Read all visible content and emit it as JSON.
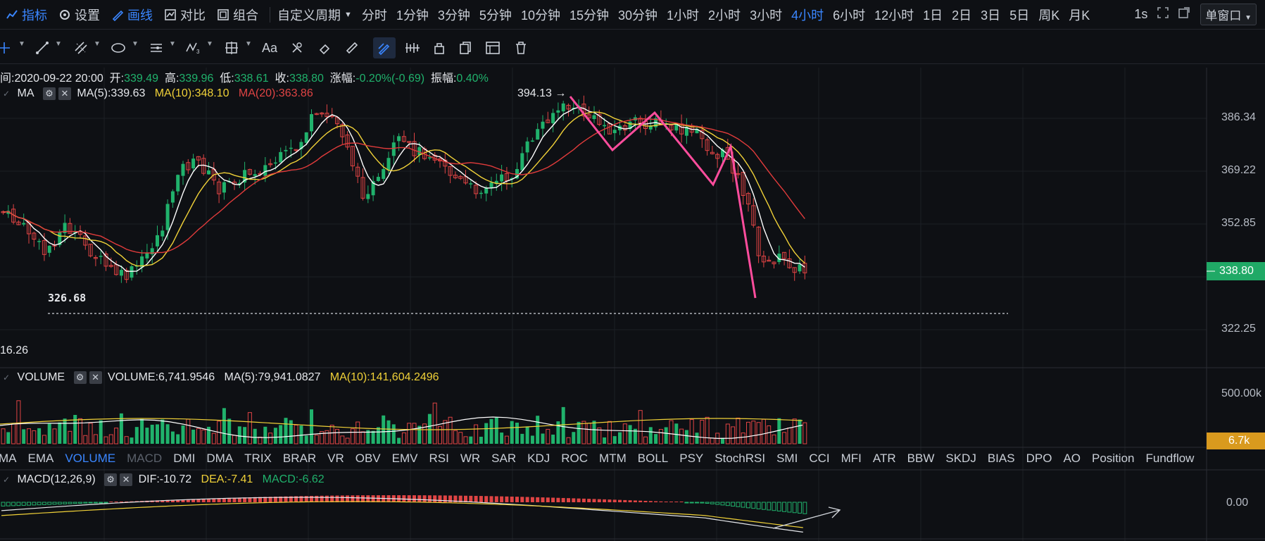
{
  "topbar": {
    "left": [
      {
        "icon": "indicator-icon",
        "label": "指标",
        "active": true
      },
      {
        "icon": "settings-icon",
        "label": "设置",
        "active": false
      },
      {
        "icon": "draw-line-icon",
        "label": "画线",
        "active": true
      },
      {
        "icon": "compare-icon",
        "label": "对比",
        "active": false
      },
      {
        "icon": "combine-icon",
        "label": "组合",
        "active": false
      }
    ],
    "custom_period": "自定义周期",
    "periods": [
      "分时",
      "1分钟",
      "3分钟",
      "5分钟",
      "10分钟",
      "15分钟",
      "30分钟",
      "1小时",
      "2小时",
      "3小时",
      "4小时",
      "6小时",
      "12小时",
      "1日",
      "2日",
      "3日",
      "5日",
      "周K",
      "月K"
    ],
    "active_period": "4小时",
    "refresh": "1s",
    "window_mode": "单窗口"
  },
  "ohlc": {
    "time_label": "间:2020-09-22 20:00",
    "open_label": "开:",
    "open": "339.49",
    "high_label": "高:",
    "high": "339.96",
    "low_label": "低:",
    "low": "338.61",
    "close_label": "收:",
    "close": "338.80",
    "change_label": "涨幅:",
    "change": "-0.20%(-0.69)",
    "amp_label": "振幅:",
    "amp": "0.40%"
  },
  "ma_legend": {
    "name": "MA",
    "ma5": "MA(5):339.63",
    "ma10": "MA(10):348.10",
    "ma20": "MA(20):363.86"
  },
  "price_axis": [
    "386.34",
    "369.22",
    "352.85",
    "322.25"
  ],
  "current_price": "338.80",
  "annotations": {
    "high": "394.13",
    "low": "326.68",
    "left_edge": "16.26"
  },
  "volume_legend": {
    "name": "VOLUME",
    "value": "VOLUME:6,741.9546",
    "ma5": "MA(5):79,941.0827",
    "ma10": "MA(10):141,604.2496"
  },
  "volume_axis": {
    "top": "500.00k",
    "current": "6.7k"
  },
  "indicator_tabs": [
    "MA",
    "EMA",
    "VOLUME",
    "MACD",
    "DMI",
    "DMA",
    "TRIX",
    "BRAR",
    "VR",
    "OBV",
    "EMV",
    "RSI",
    "WR",
    "SAR",
    "KDJ",
    "ROC",
    "MTM",
    "BOLL",
    "PSY",
    "StochRSI",
    "SMI",
    "CCI",
    "MFI",
    "ATR",
    "BBW",
    "SKDJ",
    "BIAS",
    "DPO",
    "AO",
    "Position",
    "Fundflow"
  ],
  "active_indicator": "VOLUME",
  "dim_indicator": "MACD",
  "macd_legend": {
    "name": "MACD(12,26,9)",
    "dif": "DIF:-10.72",
    "dea": "DEA:-7.41",
    "macd": "MACD:-6.62"
  },
  "macd_axis": "0.00",
  "colors": {
    "up": "#20b26c",
    "down": "#e04444",
    "ma5": "#ffffff",
    "ma10": "#f0d138",
    "ma20": "#e03b3b",
    "draw": "#ff4d9d",
    "accent": "#3a86ff",
    "volume_tag": "#d99a1e"
  }
}
